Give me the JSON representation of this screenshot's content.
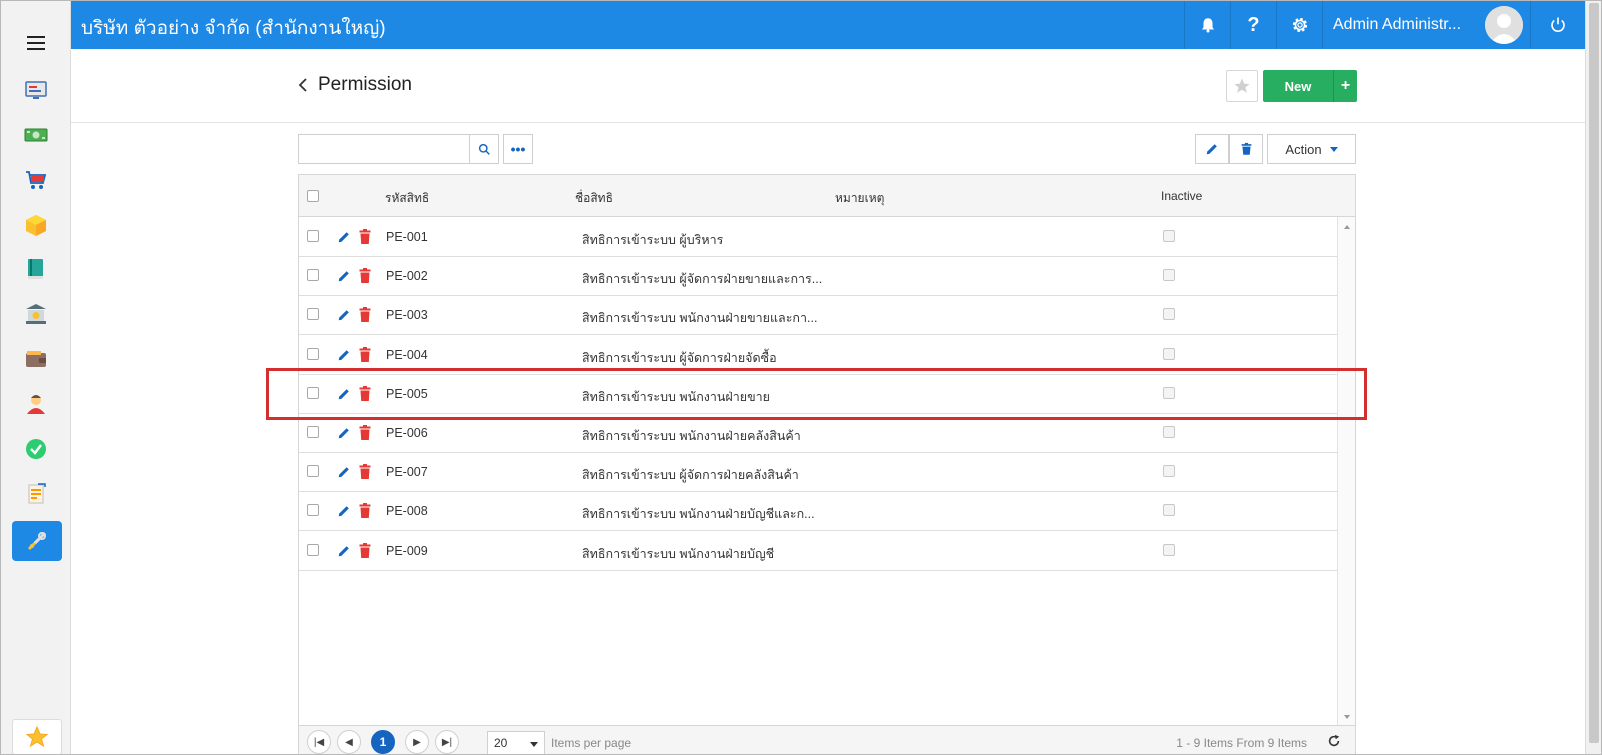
{
  "topbar": {
    "company": "บริษัท ตัวอย่าง จำกัด (สำนักงานใหญ่)",
    "user_name": "Admin Administr..."
  },
  "page": {
    "title": "Permission"
  },
  "toolbar": {
    "new_label": "New",
    "plus_label": "+",
    "more_label": "•••",
    "action_label": "Action",
    "search_value": ""
  },
  "grid": {
    "columns": {
      "code": "รหัสสิทธิ",
      "name": "ชื่อสิทธิ",
      "remark": "หมายเหตุ",
      "inactive": "Inactive"
    },
    "rows": [
      {
        "code": "PE-001",
        "name": "สิทธิการเข้าระบบ ผู้บริหาร"
      },
      {
        "code": "PE-002",
        "name": "สิทธิการเข้าระบบ ผู้จัดการฝ่ายขายและการ..."
      },
      {
        "code": "PE-003",
        "name": "สิทธิการเข้าระบบ พนักงานฝ่ายขายและกา..."
      },
      {
        "code": "PE-004",
        "name": "สิทธิการเข้าระบบ ผู้จัดการฝ่ายจัดซื้อ"
      },
      {
        "code": "PE-005",
        "name": "สิทธิการเข้าระบบ พนักงานฝ่ายขาย"
      },
      {
        "code": "PE-006",
        "name": "สิทธิการเข้าระบบ พนักงานฝ่ายคลังสินค้า"
      },
      {
        "code": "PE-007",
        "name": "สิทธิการเข้าระบบ ผู้จัดการฝ่ายคลังสินค้า"
      },
      {
        "code": "PE-008",
        "name": "สิทธิการเข้าระบบ พนักงานฝ่ายบัญชีและก..."
      },
      {
        "code": "PE-009",
        "name": "สิทธิการเข้าระบบ พนักงานฝ่ายบัญชี"
      }
    ],
    "highlighted_row": "PE-005"
  },
  "pager": {
    "current_page": "1",
    "page_size": "20",
    "items_per_page_label": "Items per page",
    "info": "1 - 9 Items From 9 Items"
  },
  "colors": {
    "primary": "#1e88e5",
    "success": "#27ae60",
    "danger": "#e53935",
    "highlight": "#d32f2f"
  },
  "sidebar_icons": [
    "dashboard-icon",
    "money-icon",
    "cart-icon",
    "box-icon",
    "book-icon",
    "bank-icon",
    "wallet-icon",
    "user-icon",
    "check-icon",
    "report-icon"
  ]
}
